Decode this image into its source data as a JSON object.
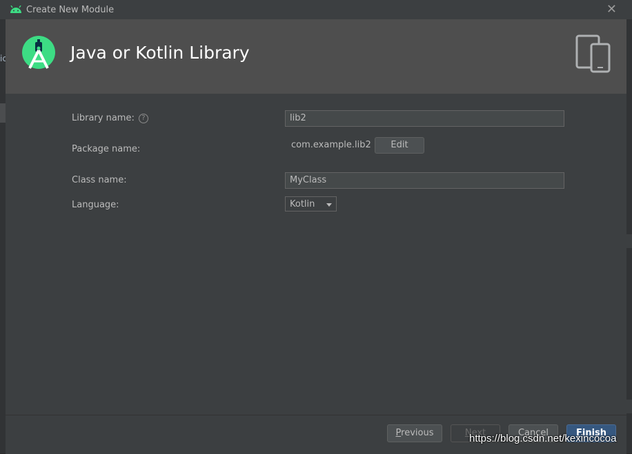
{
  "window": {
    "title": "Create New Module",
    "close_icon": "close-icon"
  },
  "header": {
    "title": "Java or Kotlin Library",
    "logo_icon": "android-studio-icon",
    "device_icon": "phone-tablet-icon"
  },
  "form": {
    "library_name_label": "Library name:",
    "library_name_value": "lib2",
    "package_name_label": "Package name:",
    "package_name_value": "com.example.lib2",
    "edit_label": "Edit",
    "class_name_label": "Class name:",
    "class_name_value": "MyClass",
    "language_label": "Language:",
    "language_value": "Kotlin"
  },
  "footer": {
    "previous_mnemonic": "P",
    "previous_rest": "revious",
    "next_mnemonic": "N",
    "next_rest": "ext",
    "cancel_label": "Cancel",
    "finish_mnemonic": "F",
    "finish_rest": "inish"
  },
  "background": {
    "left_text": "ic"
  },
  "watermark": "https://blog.csdn.net/kexincocoa",
  "colors": {
    "accent": "#3ddc84",
    "primary_button": "#365880",
    "header_bg": "#4e4e4e",
    "dialog_bg": "#3c3f41"
  }
}
